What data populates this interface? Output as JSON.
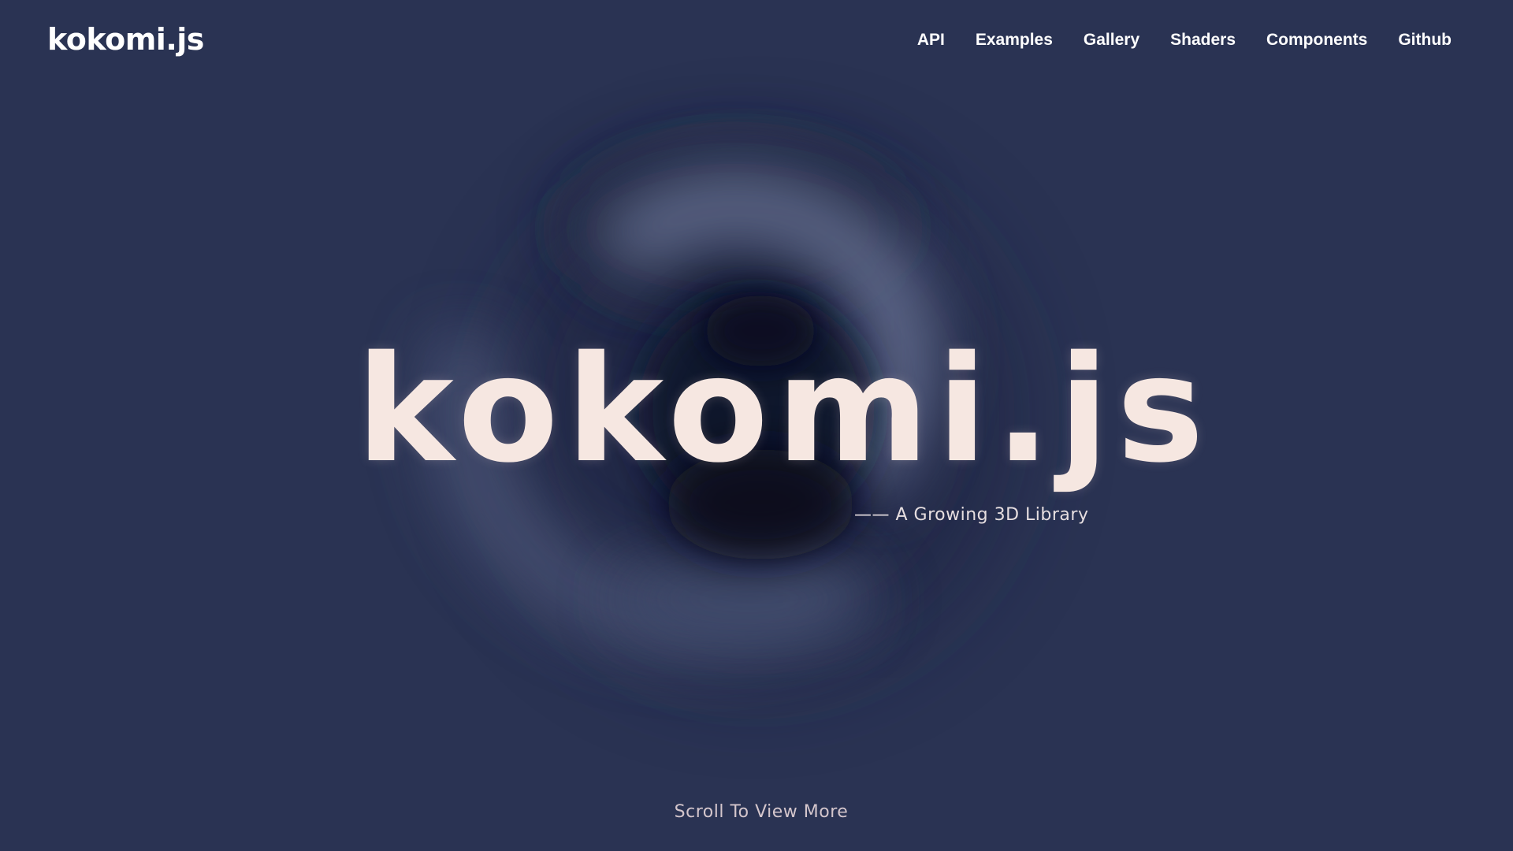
{
  "header": {
    "logo": "kokomi.js",
    "nav": [
      {
        "name": "nav-api",
        "label": "API"
      },
      {
        "name": "nav-examples",
        "label": "Examples"
      },
      {
        "name": "nav-gallery",
        "label": "Gallery"
      },
      {
        "name": "nav-shaders",
        "label": "Shaders"
      },
      {
        "name": "nav-components",
        "label": "Components"
      },
      {
        "name": "nav-github",
        "label": "Github"
      }
    ]
  },
  "hero": {
    "title": "kokomi.js",
    "subtitle": "—— A Growing 3D Library"
  },
  "footer": {
    "scroll_hint": "Scroll To View More"
  },
  "colors": {
    "background": "#2a3353",
    "title": "#f6e7e1",
    "text": "#ffffff",
    "blob_light": "#6a7496",
    "blob_dark": "#0f1024"
  }
}
